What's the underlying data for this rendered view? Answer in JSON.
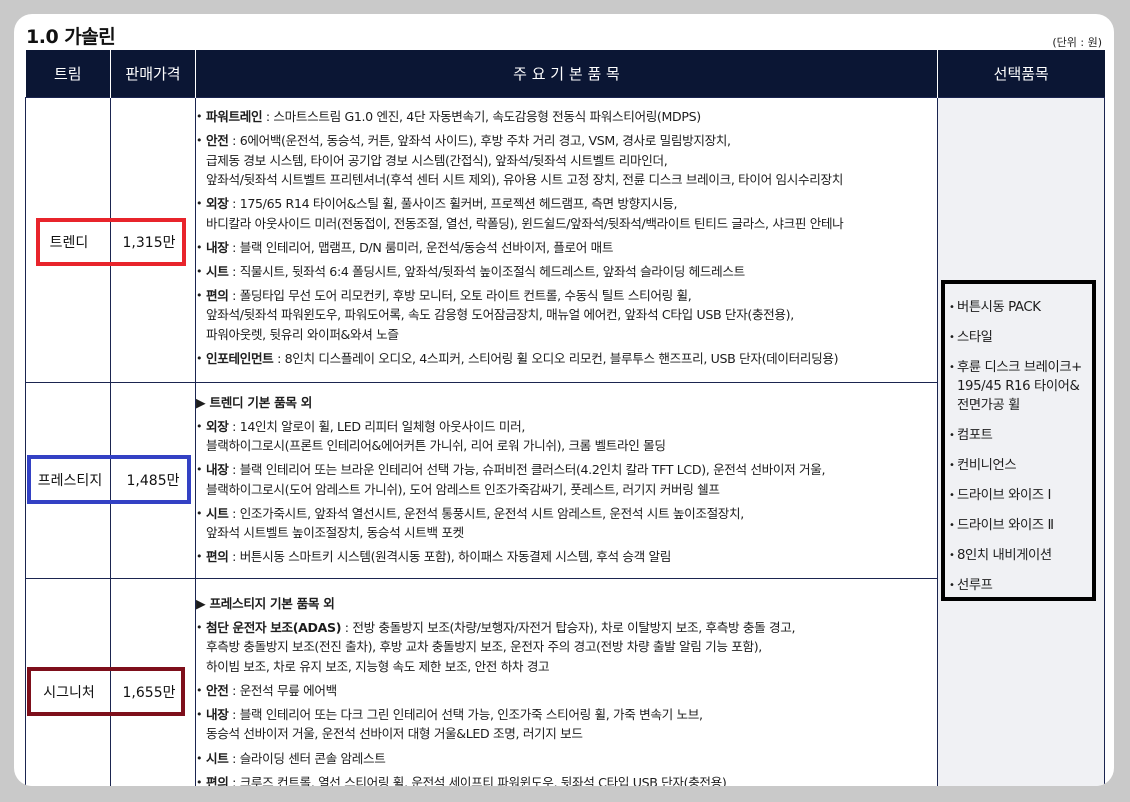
{
  "section_title": "1.0 가솔린",
  "unit_note": "(단위 : 원)",
  "headers": {
    "trim": "트림",
    "price": "판매가격",
    "main": "주 요 기 본 품 목",
    "options": "선택품목"
  },
  "trims": [
    {
      "name": "트렌디",
      "price": "1,315만",
      "highlight": "#e8242b",
      "lead": "",
      "items": [
        {
          "key": "파워트레인",
          "lines": [
            "스마트스트림 G1.0 엔진, 4단 자동변속기, 속도감응형 전동식 파워스티어링(MDPS)"
          ]
        },
        {
          "key": "안전",
          "lines": [
            "6에어백(운전석, 동승석, 커튼, 앞좌석 사이드), 후방 주차 거리 경고, VSM, 경사로 밀림방지장치,",
            "급제동 경보 시스템, 타이어 공기압 경보 시스템(간접식), 앞좌석/뒷좌석 시트벨트 리마인더,",
            "앞좌석/뒷좌석 시트벨트 프리텐셔너(후석 센터 시트 제외), 유아용 시트 고정 장치, 전륜 디스크 브레이크, 타이어 임시수리장치"
          ]
        },
        {
          "key": "외장",
          "lines": [
            "175/65 R14 타이어&스틸 휠, 풀사이즈 휠커버, 프로젝션 헤드램프, 측면 방향지시등,",
            "바디칼라 아웃사이드 미러(전동접이, 전동조절, 열선, 락폴딩), 윈드쉴드/앞좌석/뒷좌석/백라이트 틴티드 글라스, 샤크핀 안테나"
          ]
        },
        {
          "key": "내장",
          "lines": [
            "블랙 인테리어, 맵램프, D/N 룸미러, 운전석/동승석 선바이저, 플로어 매트"
          ]
        },
        {
          "key": "시트",
          "lines": [
            "직물시트, 뒷좌석 6:4 폴딩시트, 앞좌석/뒷좌석 높이조절식 헤드레스트, 앞좌석 슬라이딩 헤드레스트"
          ]
        },
        {
          "key": "편의",
          "lines": [
            "폴딩타입 무선 도어 리모컨키, 후방 모니터, 오토 라이트 컨트롤, 수동식 틸트 스티어링 휠,",
            "앞좌석/뒷좌석 파워윈도우, 파워도어록, 속도 감응형 도어잠금장치, 매뉴얼 에어컨, 앞좌석 C타입 USB 단자(충전용),",
            "파워아웃렛, 뒷유리 와이퍼&와셔 노즐"
          ]
        },
        {
          "key": "인포테인먼트",
          "lines": [
            "8인치 디스플레이 오디오, 4스피커, 스티어링 휠 오디오 리모컨, 블루투스 핸즈프리, USB 단자(데이터리딩용)"
          ]
        }
      ]
    },
    {
      "name": "프레스티지",
      "price": "1,485만",
      "highlight": "#3341c4",
      "lead": "▶ 트렌디 기본 품목 외",
      "items": [
        {
          "key": "외장",
          "lines": [
            "14인치 알로이 휠, LED 리피터 일체형 아웃사이드 미러,",
            "블랙하이그로시(프론트 인테리어&에어커튼 가니쉬, 리어 로워 가니쉬), 크롬 벨트라인 몰딩"
          ]
        },
        {
          "key": "내장",
          "lines": [
            "블랙 인테리어 또는 브라운 인테리어 선택 가능, 슈퍼비전 클러스터(4.2인치 칼라 TFT LCD), 운전석 선바이저 거울,",
            "블랙하이그로시(도어 암레스트 가니쉬), 도어 암레스트 인조가죽감싸기, 풋레스트, 러기지 커버링 쉘프"
          ]
        },
        {
          "key": "시트",
          "lines": [
            "인조가죽시트, 앞좌석 열선시트, 운전석 통풍시트, 운전석 시트 암레스트, 운전석 시트 높이조절장치,",
            "앞좌석 시트벨트 높이조절장치, 동승석 시트백 포켓"
          ]
        },
        {
          "key": "편의",
          "lines": [
            "버튼시동 스마트키 시스템(원격시동 포함), 하이패스 자동결제 시스템, 후석 승객 알림"
          ]
        }
      ]
    },
    {
      "name": "시그니처",
      "price": "1,655만",
      "highlight": "#7e0f1b",
      "lead": "▶ 프레스티지 기본 품목 외",
      "items": [
        {
          "key": "첨단 운전자 보조(ADAS)",
          "lines": [
            "전방 충돌방지 보조(차량/보행자/자전거 탑승자), 차로 이탈방지 보조, 후측방 충돌 경고,",
            "후측방 충돌방지 보조(전진 출차), 후방 교차 충돌방지 보조, 운전자 주의 경고(전방 차량 출발 알림 기능 포함),",
            "하이빔 보조, 차로 유지 보조, 지능형 속도 제한 보조, 안전 하차 경고"
          ]
        },
        {
          "key": "안전",
          "lines": [
            "운전석 무릎 에어백"
          ]
        },
        {
          "key": "내장",
          "lines": [
            "블랙 인테리어 또는 다크 그린 인테리어 선택 가능, 인조가죽 스티어링 휠, 가죽 변속기 노브,",
            "동승석 선바이저 거울, 운전석 선바이저 대형 거울&LED 조명, 러기지 보드"
          ]
        },
        {
          "key": "시트",
          "lines": [
            "슬라이딩 센터 콘솔 암레스트"
          ]
        },
        {
          "key": "편의",
          "lines": [
            "크루즈 컨트롤, 열선 스티어링 휠, 운전석 세이프티 파워윈도우, 뒷좌석 C타입 USB 단자(충전용)"
          ]
        }
      ]
    }
  ],
  "options": [
    "버튼시동 PACK",
    "스타일",
    "후륜 디스크 브레이크+ 195/45 R16 타이어& 전면가공 휠",
    "컴포트",
    "컨비니언스",
    "드라이브 와이즈 Ⅰ",
    "드라이브 와이즈 Ⅱ",
    "8인치 내비게이션",
    "선루프"
  ]
}
